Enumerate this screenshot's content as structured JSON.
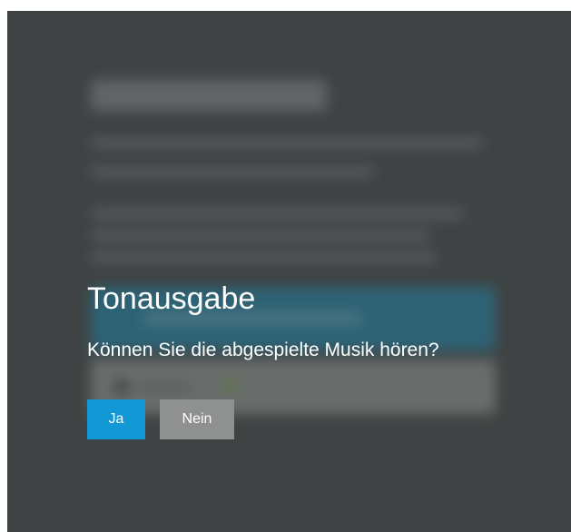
{
  "dialog": {
    "title": "Tonausgabe",
    "question": "Können Sie die abgespielte Musik hören?",
    "yes_label": "Ja",
    "no_label": "Nein"
  },
  "colors": {
    "overlay_background": "#3f4343",
    "yes_button": "#1298d4",
    "no_button": "#8f9191",
    "text": "#ffffff"
  }
}
